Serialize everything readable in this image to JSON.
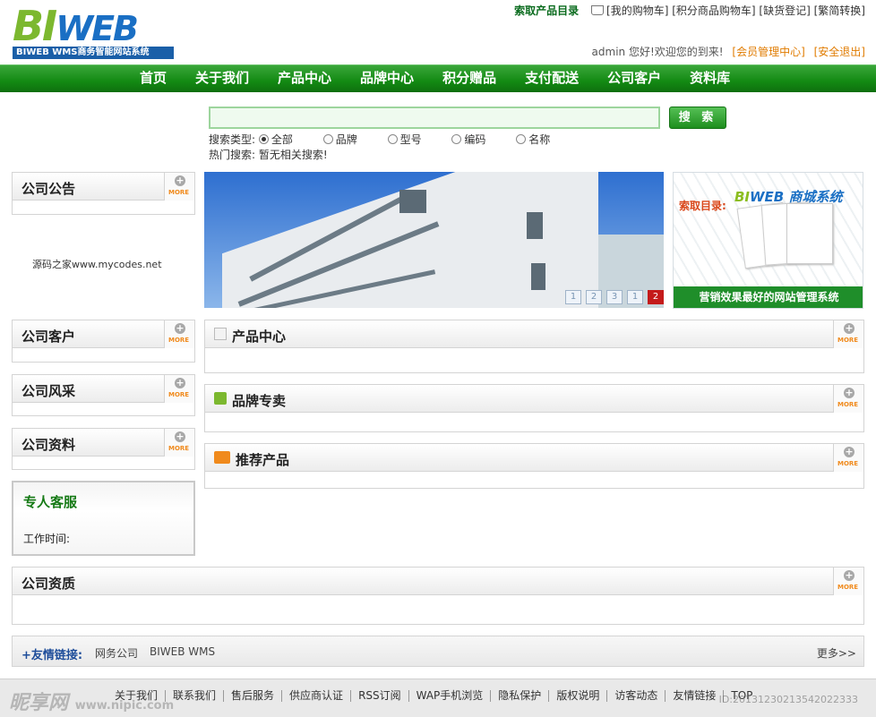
{
  "header": {
    "logo_bi": "BI",
    "logo_web": "WEB",
    "logo_sub": "BIWEB WMS商务智能网站系统",
    "catalog_link": "索取产品目录",
    "top_links": [
      "[我的购物车]",
      "[积分商品购物车]",
      "[缺货登记]",
      "[繁简转换]"
    ],
    "welcome": "admin 您好!欢迎您的到来!",
    "member_link": "[会员管理中心]",
    "logout_link": "[安全退出]"
  },
  "nav": [
    "首页",
    "关于我们",
    "产品中心",
    "品牌中心",
    "积分赠品",
    "支付配送",
    "公司客户",
    "资料库"
  ],
  "search": {
    "value": "",
    "button": "搜 索",
    "type_label": "搜索类型:",
    "types": [
      "全部",
      "品牌",
      "型号",
      "编码",
      "名称"
    ],
    "selected_type": "全部",
    "hot_label": "热门搜索:",
    "hot_value": "暂无相关搜索!"
  },
  "more_label": "MORE",
  "sidebar": {
    "notice_title": "公司公告",
    "notice_text": "源码之家www.mycodes.net",
    "clients_title": "公司客户",
    "style_title": "公司风采",
    "docs_title": "公司资料",
    "service_title": "专人客服",
    "service_time": "工作时间:"
  },
  "banner": {
    "pages": [
      "1",
      "2",
      "3",
      "1",
      "2"
    ],
    "active_page": 4
  },
  "ad": {
    "brand_a": "BI",
    "brand_b": "WEB",
    "brand_c": " 商城系统",
    "catalog": "索取目录:",
    "footer": "营销效果最好的网站管理系统"
  },
  "main": {
    "products_title": "产品中心",
    "brands_title": "品牌专卖",
    "recommend_title": "推荐产品",
    "qualification_title": "公司资质"
  },
  "friend_links": {
    "label": "+友情链接:",
    "items": [
      "网务公司",
      "BIWEB WMS"
    ],
    "more": "更多>>"
  },
  "footer": {
    "items": [
      "关于我们",
      "联系我们",
      "售后服务",
      "供应商认证",
      "RSS订阅",
      "WAP手机浏览",
      "隐私保护",
      "版权说明",
      "访客动态",
      "友情链接",
      "TOP"
    ],
    "watermark": "昵享网",
    "watermark_url": "www.nipic.com",
    "watermark_id": "ID:20131230213542022333"
  },
  "colors": {
    "nav_green": "#138a13",
    "accent_orange": "#e07b00",
    "link_blue": "#1e4d9a"
  }
}
